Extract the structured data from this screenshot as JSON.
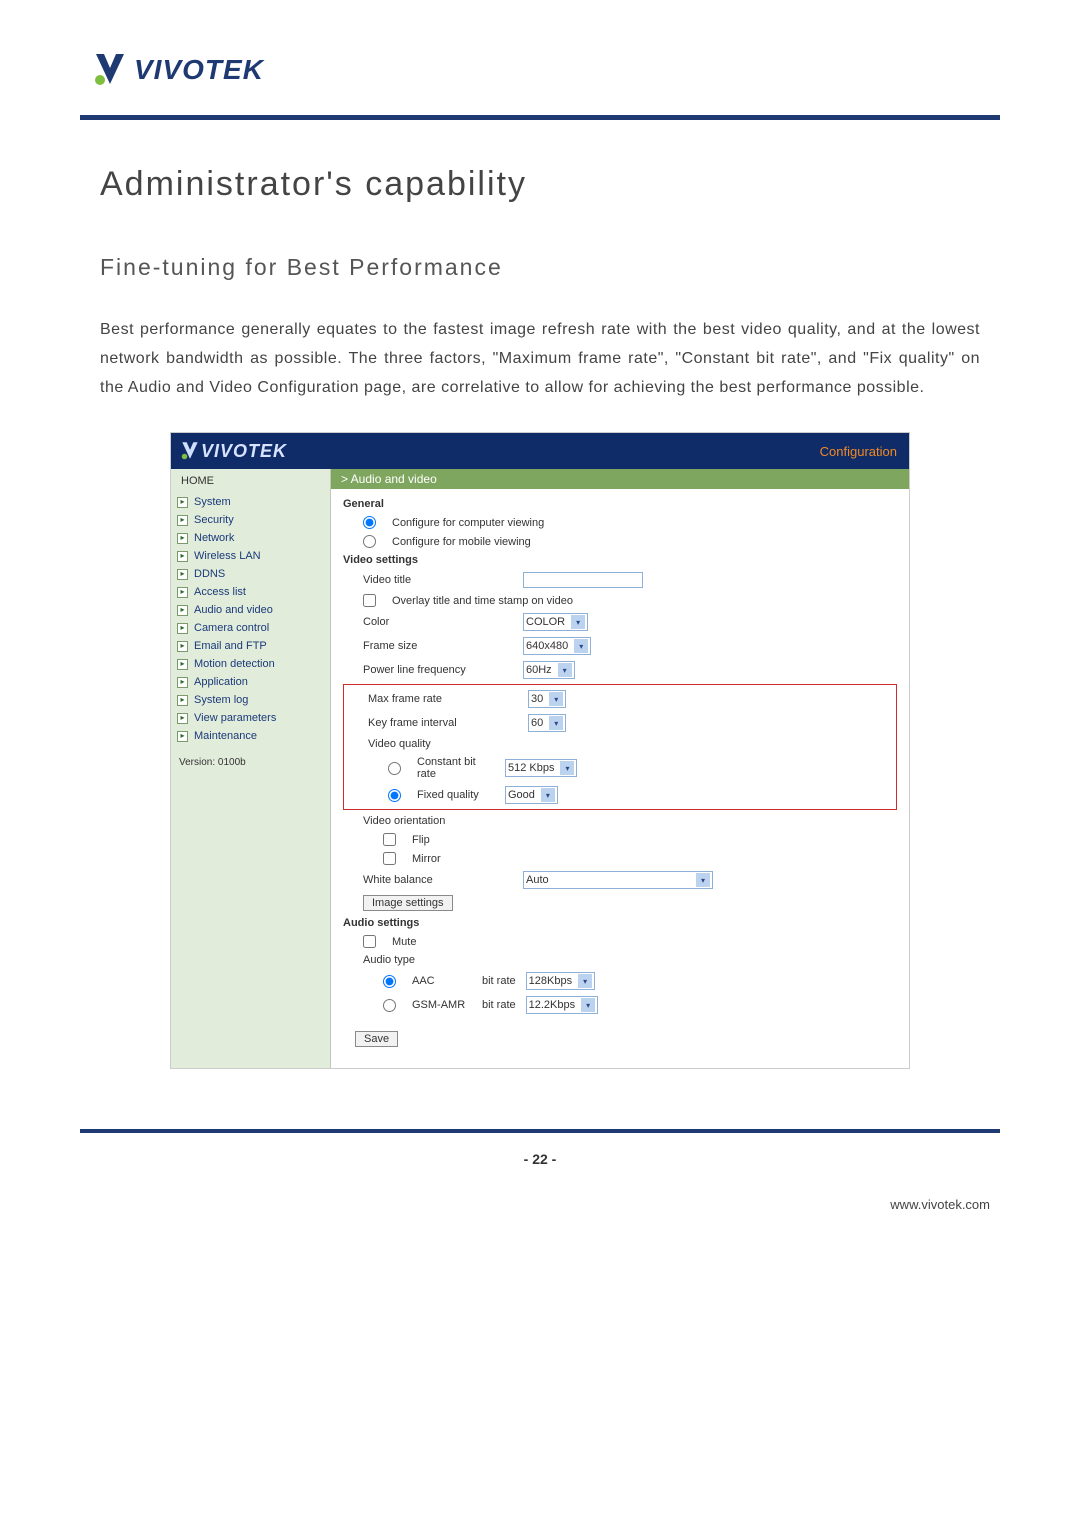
{
  "brand": "VIVOTEK",
  "heading": "Administrator's capability",
  "subheading": "Fine-tuning for Best Performance",
  "paragraph": "Best performance generally equates to the fastest image refresh rate with the best video quality, and at the lowest network bandwidth as possible. The three factors, \"Maximum frame rate\", \"Constant bit rate\", and \"Fix quality\" on the Audio and Video Configuration page, are correlative to allow for achieving the best performance possible.",
  "config": {
    "header_link": "Configuration",
    "nav": {
      "home": "HOME",
      "items": [
        "System",
        "Security",
        "Network",
        "Wireless LAN",
        "DDNS",
        "Access list",
        "Audio and video",
        "Camera control",
        "Email and FTP",
        "Motion detection",
        "Application",
        "System log",
        "View parameters",
        "Maintenance"
      ],
      "version": "Version: 0100b"
    },
    "panel_title": "> Audio and video",
    "general": {
      "heading": "General",
      "computer_view": "Configure for computer viewing",
      "mobile_view": "Configure for mobile viewing"
    },
    "video": {
      "heading": "Video settings",
      "title_label": "Video title",
      "title_value": "",
      "overlay": "Overlay title and time stamp on video",
      "color_label": "Color",
      "color_value": "COLOR",
      "frame_size_label": "Frame size",
      "frame_size_value": "640x480",
      "plf_label": "Power line frequency",
      "plf_value": "60Hz",
      "mfr_label": "Max frame rate",
      "mfr_value": "30",
      "kfi_label": "Key frame interval",
      "kfi_value": "60",
      "quality_label": "Video quality",
      "cbr_label": "Constant bit rate",
      "cbr_value": "512 Kbps",
      "fq_label": "Fixed quality",
      "fq_value": "Good",
      "orientation_label": "Video orientation",
      "flip": "Flip",
      "mirror": "Mirror",
      "wb_label": "White balance",
      "wb_value": "Auto",
      "image_settings_btn": "Image settings"
    },
    "audio": {
      "heading": "Audio settings",
      "mute": "Mute",
      "type_label": "Audio type",
      "aac_label": "AAC",
      "bitrate_label": "bit rate",
      "aac_value": "128Kbps",
      "gsm_label": "GSM-AMR",
      "gsm_value": "12.2Kbps"
    },
    "save": "Save"
  },
  "page_number": "- 22 -",
  "footer_url": "www.vivotek.com"
}
